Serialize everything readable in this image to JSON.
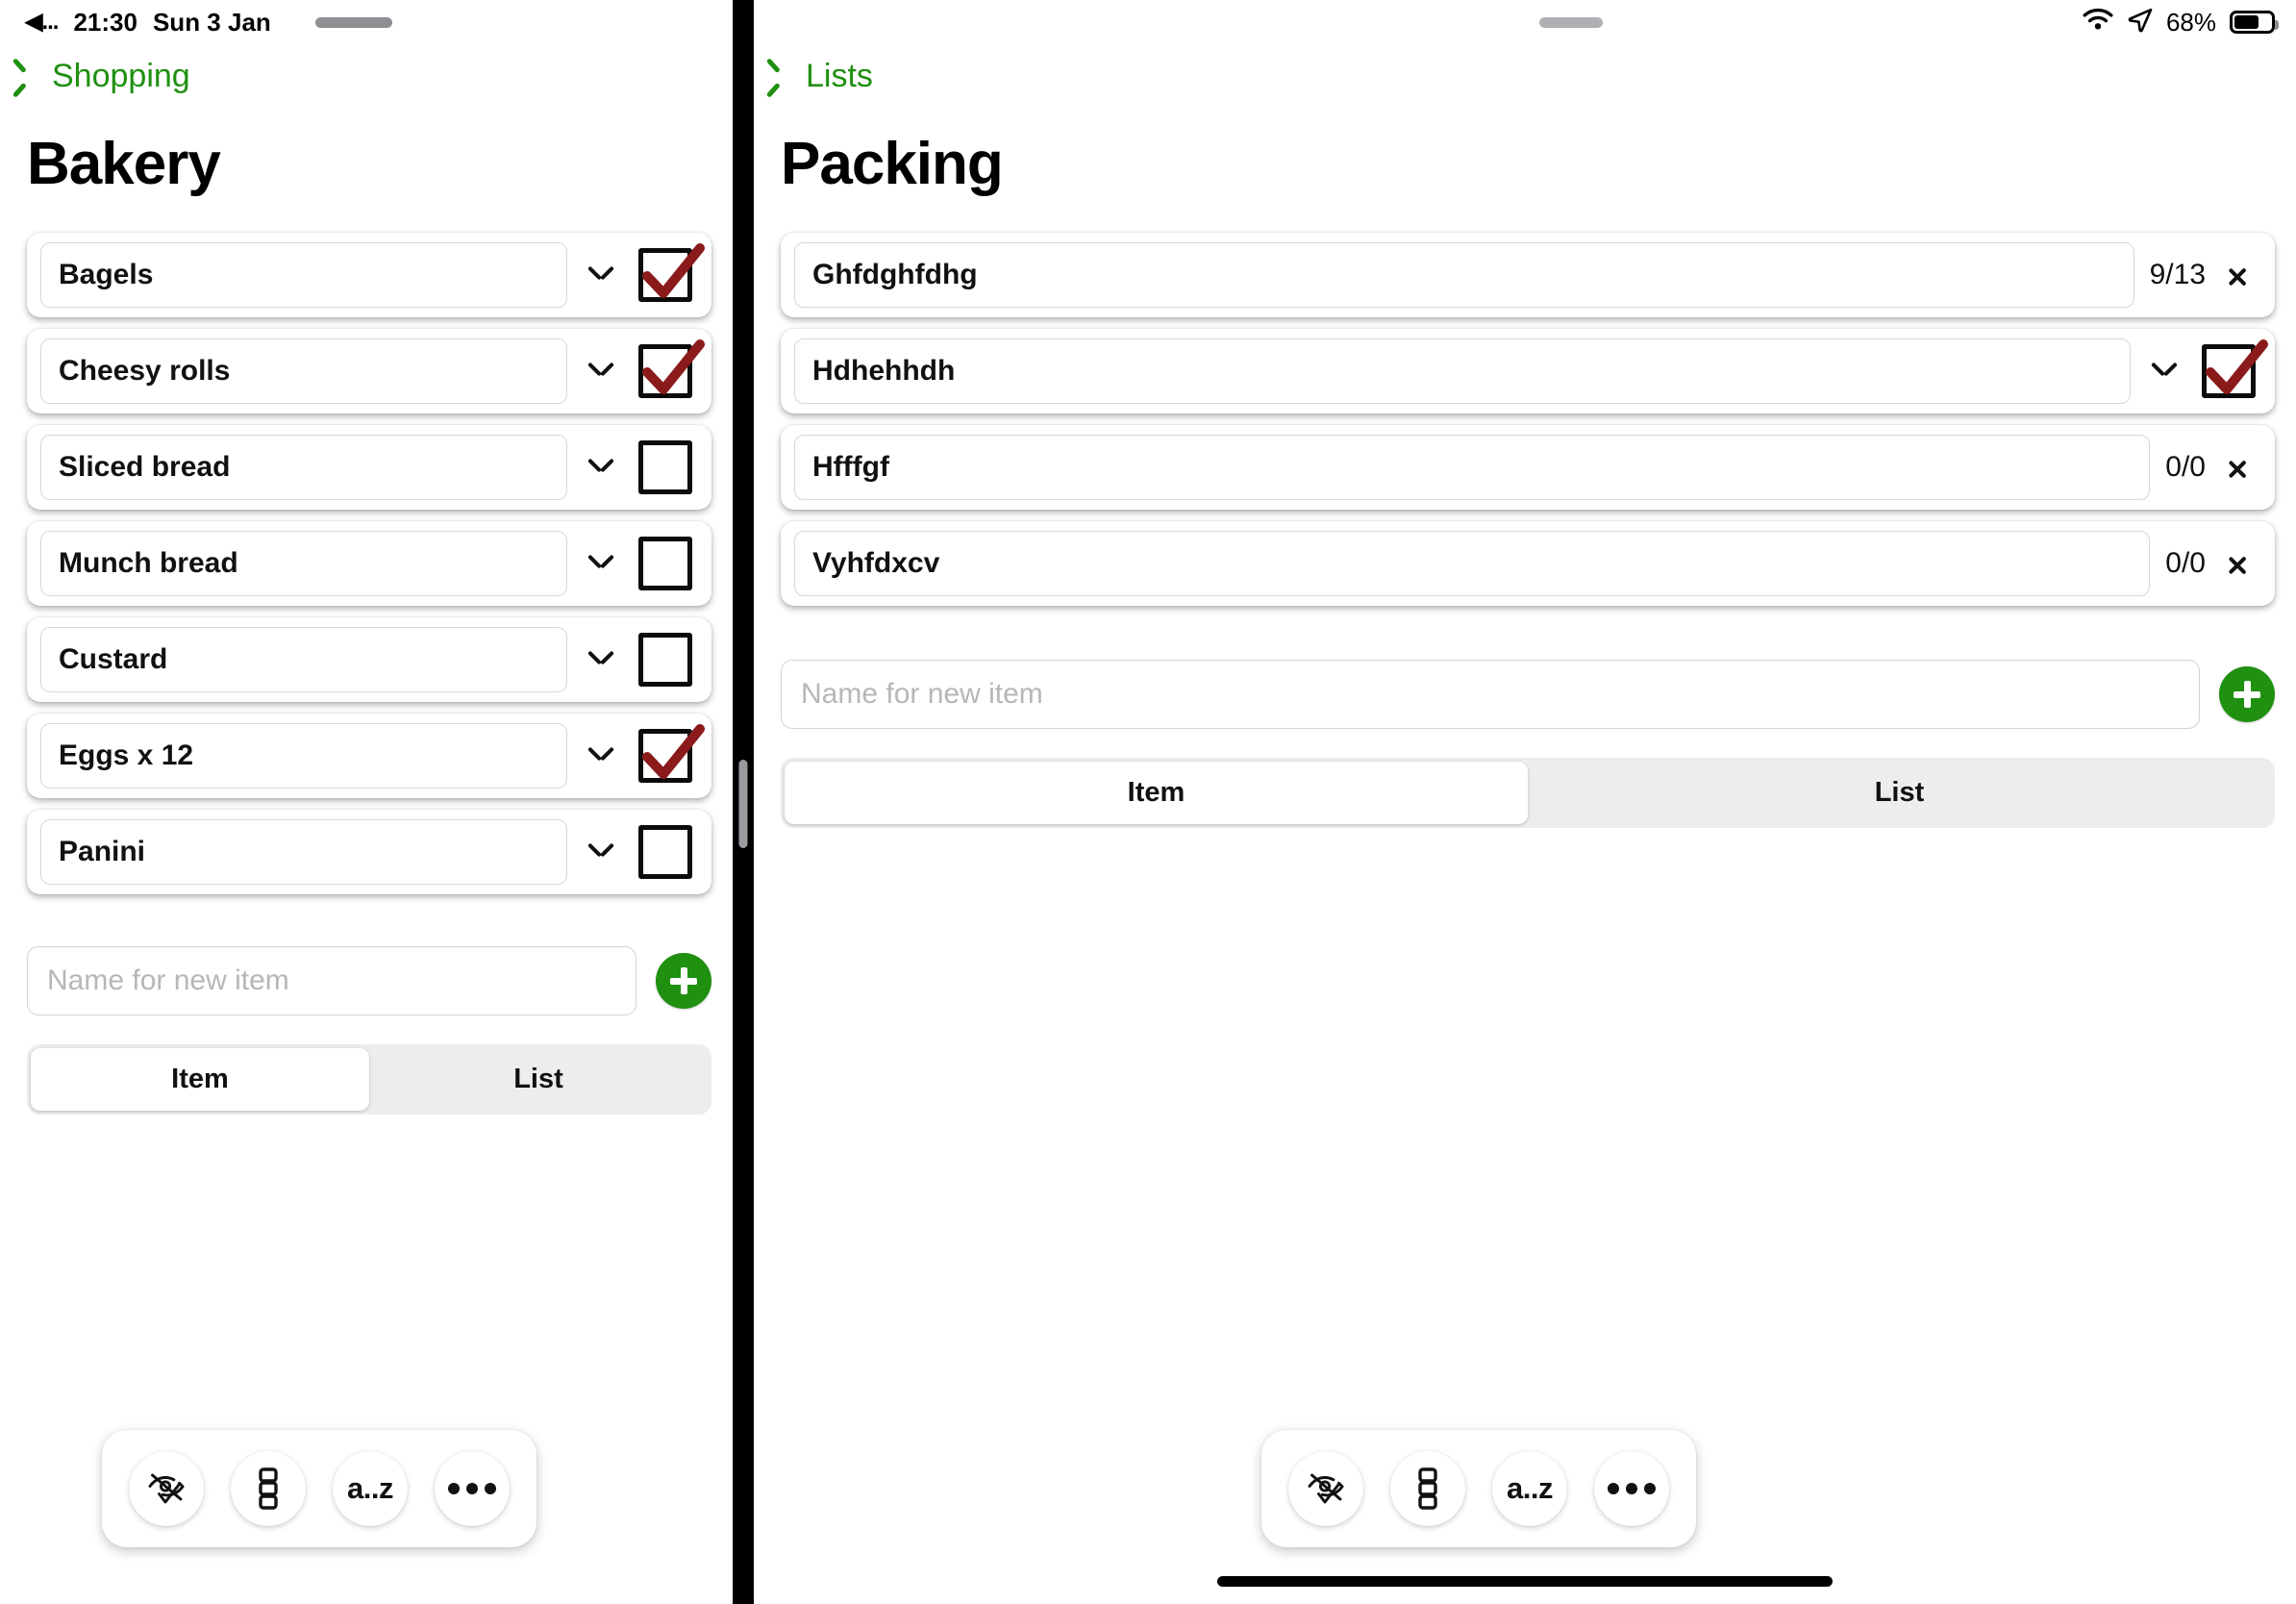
{
  "status_bar": {
    "back_glyph": "◀...",
    "time": "21:30",
    "date": "Sun 3 Jan",
    "battery_percent": "68%",
    "wifi_icon": "wifi-icon",
    "location_icon": "location-arrow-icon",
    "battery_icon": "battery-icon",
    "battery_level": 68
  },
  "colors": {
    "accent_green": "#1f9010",
    "check_red": "#8B1A1A",
    "segment_track": "#ededee",
    "divider": "#000000"
  },
  "left_panel": {
    "back_label": "Shopping",
    "title": "Bakery",
    "items": [
      {
        "name": "Bagels",
        "checked": true,
        "has_chevron_down": true
      },
      {
        "name": "Cheesy rolls",
        "checked": true,
        "has_chevron_down": true
      },
      {
        "name": "Sliced bread",
        "checked": false,
        "has_chevron_down": true
      },
      {
        "name": "Munch bread",
        "checked": false,
        "has_chevron_down": true
      },
      {
        "name": "Custard",
        "checked": false,
        "has_chevron_down": true
      },
      {
        "name": "Eggs x 12",
        "checked": true,
        "has_chevron_down": true
      },
      {
        "name": "Panini",
        "checked": false,
        "has_chevron_down": true
      }
    ],
    "new_item": {
      "value": "",
      "placeholder": "Name for new item"
    },
    "add_button_label": "+",
    "segmented": {
      "options": [
        "Item",
        "List"
      ],
      "selected": "Item"
    },
    "toolbar": [
      {
        "icon": "hide-checked-icon",
        "label": ""
      },
      {
        "icon": "stacked-squares-icon",
        "label": ""
      },
      {
        "icon": "sort-az-icon",
        "label": "a..z"
      },
      {
        "icon": "more-ellipsis-icon",
        "label": ""
      }
    ]
  },
  "right_panel": {
    "back_label": "Lists",
    "title": "Packing",
    "items": [
      {
        "name": "Ghfdghfdhg",
        "type": "list",
        "count": "9/13",
        "checked": false,
        "has_chevron_down": false
      },
      {
        "name": "Hdhehhdh",
        "type": "item",
        "count": "",
        "checked": true,
        "has_chevron_down": true
      },
      {
        "name": "Hfffgf",
        "type": "list",
        "count": "0/0",
        "checked": false,
        "has_chevron_down": false
      },
      {
        "name": "Vyhfdxcv",
        "type": "list",
        "count": "0/0",
        "checked": false,
        "has_chevron_down": false
      }
    ],
    "new_item": {
      "value": "",
      "placeholder": "Name for new item"
    },
    "add_button_label": "+",
    "segmented": {
      "options": [
        "Item",
        "List"
      ],
      "selected": "Item"
    },
    "toolbar": [
      {
        "icon": "hide-checked-icon",
        "label": ""
      },
      {
        "icon": "stacked-squares-icon",
        "label": ""
      },
      {
        "icon": "sort-az-icon",
        "label": "a..z"
      },
      {
        "icon": "more-ellipsis-icon",
        "label": ""
      }
    ]
  }
}
